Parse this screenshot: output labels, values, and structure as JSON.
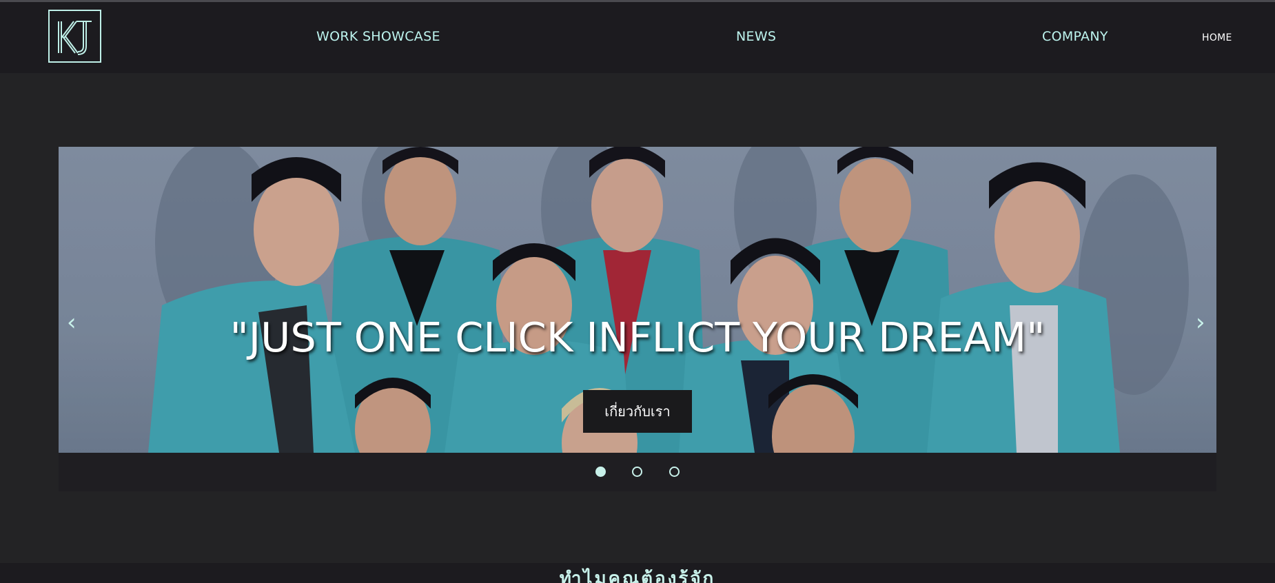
{
  "nav": {
    "logo_text": "KJ",
    "links": [
      "WORK SHOWCASE",
      "NEWS",
      "COMPANY",
      "HOME"
    ]
  },
  "hero": {
    "headline": "\"JUST ONE CLICK INFLICT YOUR DREAM\"",
    "cta_label": "เกี่ยวกับเรา",
    "prev_icon": "‹",
    "next_icon": "›",
    "slides_count": 3,
    "active_slide": 1
  },
  "section": {
    "title": "ทำไมคุณต้องรู้จัก"
  },
  "colors": {
    "accent": "#c8f1ea",
    "background": "#232325",
    "navbar": "#1c1b1f",
    "button": "#1a1a1c"
  }
}
